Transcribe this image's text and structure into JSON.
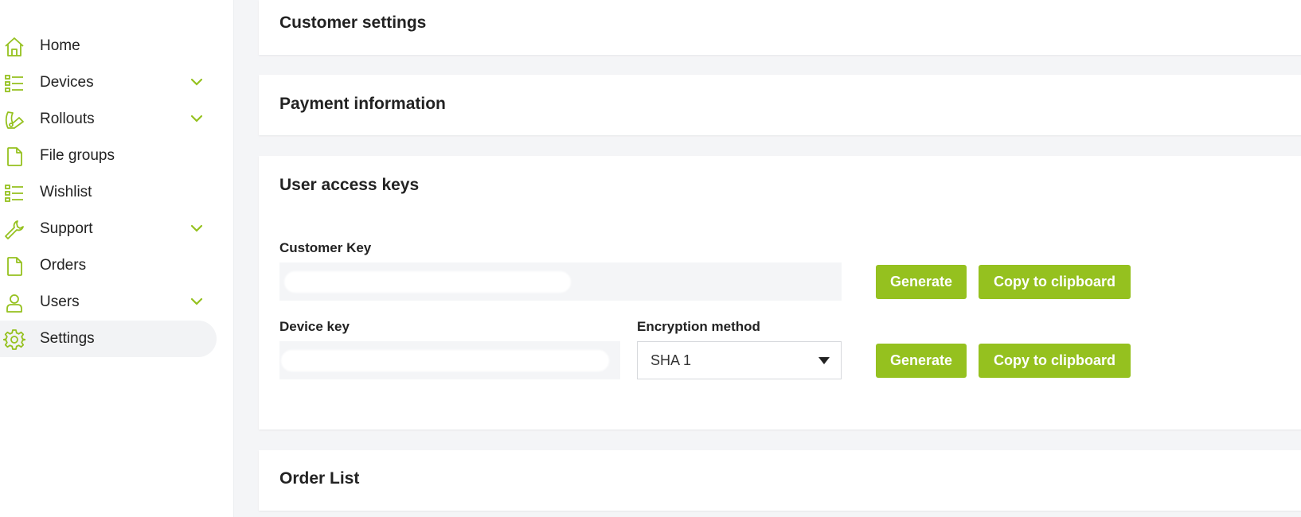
{
  "accent_color": "#95c11f",
  "sidebar": {
    "items": [
      {
        "label": "Home",
        "icon": "home-icon",
        "has_chevron": false
      },
      {
        "label": "Devices",
        "icon": "list-icon",
        "has_chevron": true
      },
      {
        "label": "Rollouts",
        "icon": "rollout-icon",
        "has_chevron": true
      },
      {
        "label": "File groups",
        "icon": "file-icon",
        "has_chevron": false
      },
      {
        "label": "Wishlist",
        "icon": "list-icon",
        "has_chevron": false
      },
      {
        "label": "Support",
        "icon": "wrench-icon",
        "has_chevron": true
      },
      {
        "label": "Orders",
        "icon": "file-icon",
        "has_chevron": false
      },
      {
        "label": "Users",
        "icon": "user-icon",
        "has_chevron": true
      },
      {
        "label": "Settings",
        "icon": "gear-icon",
        "has_chevron": false,
        "active": true
      }
    ]
  },
  "cards": {
    "customer_settings": {
      "title": "Customer settings"
    },
    "payment_information": {
      "title": "Payment information"
    },
    "user_access_keys": {
      "title": "User access keys",
      "customer_key_label": "Customer Key",
      "device_key_label": "Device key",
      "encryption_label": "Encryption method",
      "encryption_value": "SHA 1",
      "generate_label": "Generate",
      "copy_label": "Copy to clipboard"
    },
    "order_list": {
      "title": "Order List"
    }
  }
}
